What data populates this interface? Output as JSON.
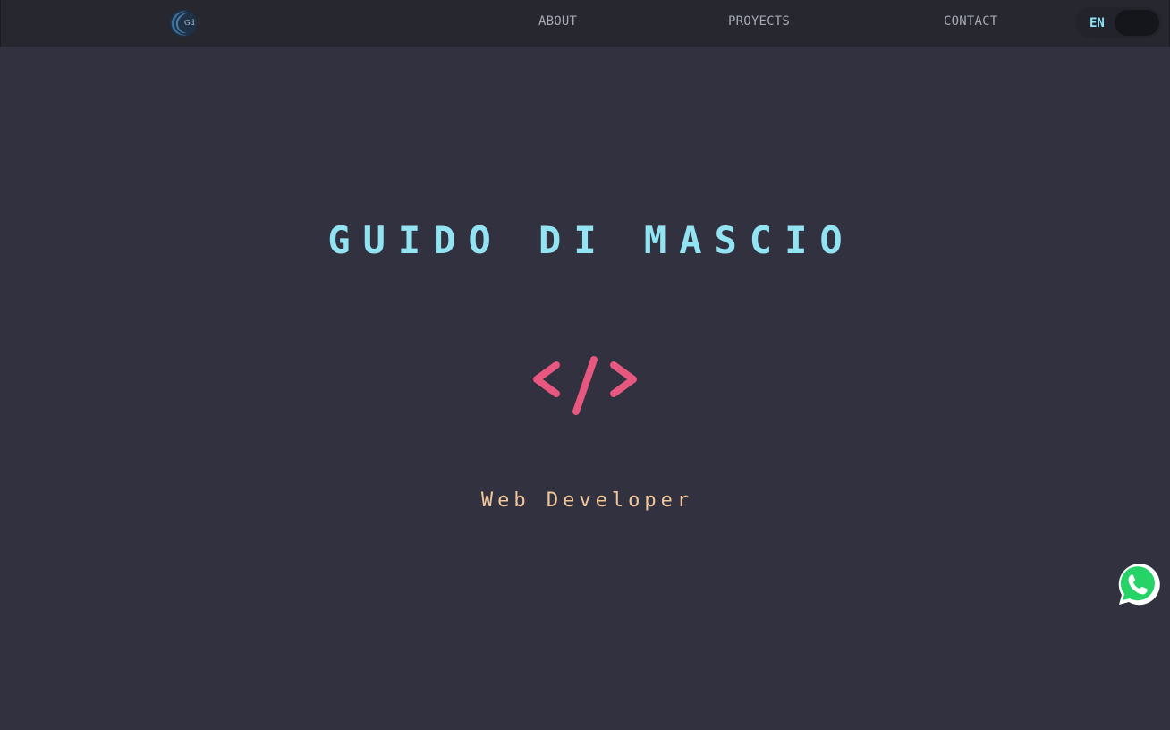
{
  "navbar": {
    "logo_text": "Gd",
    "links": {
      "about": "ABOUT",
      "proyects": "PROYECTS",
      "contact": "CONTACT"
    },
    "language_toggle": {
      "label": "EN"
    }
  },
  "hero": {
    "title": "GUIDO DI MASCIO",
    "code_symbol": "</>",
    "subtitle": "Web Developer"
  },
  "icons": {
    "logo": "gd-logo-icon",
    "code": "code-brackets-icon",
    "whatsapp": "whatsapp-icon"
  },
  "colors": {
    "background": "#31313f",
    "navbar": "#26272f",
    "title": "#93e4f3",
    "code_icon": "#e8577f",
    "subtitle": "#f2c79a",
    "whatsapp": "#25d366"
  }
}
